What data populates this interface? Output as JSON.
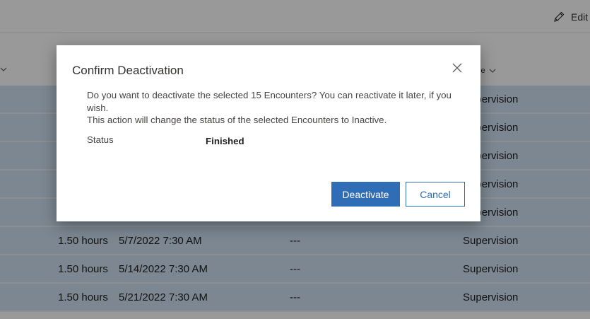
{
  "command_bar": {
    "edit_label": "Edit"
  },
  "grid": {
    "service_header_fragment": "ce",
    "rows": [
      {
        "duration": "",
        "date": "",
        "placeholder": "",
        "service": "Supervision"
      },
      {
        "duration": "",
        "date": "",
        "placeholder": "",
        "service": "Supervision"
      },
      {
        "duration": "",
        "date": "",
        "placeholder": "",
        "service": "Supervision"
      },
      {
        "duration": "",
        "date": "",
        "placeholder": "",
        "service": "Supervision"
      },
      {
        "duration": "",
        "date": "",
        "placeholder": "",
        "service": "Supervision"
      },
      {
        "duration": "1.50 hours",
        "date": "5/7/2022 7:30 AM",
        "placeholder": "---",
        "service": "Supervision"
      },
      {
        "duration": "1.50 hours",
        "date": "5/14/2022 7:30 AM",
        "placeholder": "---",
        "service": "Supervision"
      },
      {
        "duration": "1.50 hours",
        "date": "5/21/2022 7:30 AM",
        "placeholder": "---",
        "service": "Supervision"
      }
    ]
  },
  "dialog": {
    "title": "Confirm Deactivation",
    "message_line1": "Do you want to deactivate the selected 15 Encounters? You can reactivate it later, if you wish.",
    "message_line2": "This action will change the status of the selected Encounters to Inactive.",
    "status_label": "Status",
    "status_value": "Finished",
    "deactivate_label": "Deactivate",
    "cancel_label": "Cancel"
  },
  "colors": {
    "accent": "#2f6db6",
    "selected_row": "#cfe1f3"
  }
}
